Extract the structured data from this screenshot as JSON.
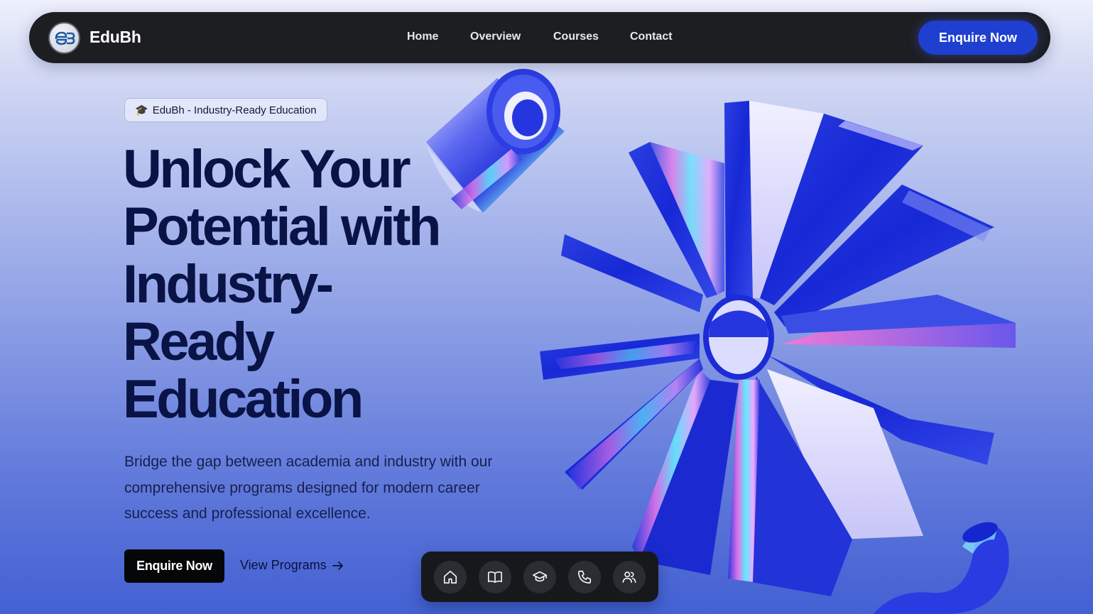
{
  "navbar": {
    "brand": "EduBh",
    "links": [
      "Home",
      "Overview",
      "Courses",
      "Contact"
    ],
    "cta": "Enquire Now"
  },
  "hero": {
    "badge": "EduBh - Industry-Ready Education",
    "headline_lines": [
      "Unlock Your",
      "Potential with",
      "Industry-",
      "Ready",
      "Education"
    ],
    "subtext": "Bridge the gap between academia and industry with our comprehensive programs designed for modern career success and professional excellence.",
    "primary_button": "Enquire Now",
    "secondary_link": "View Programs"
  },
  "dock": {
    "icons": [
      "home-icon",
      "book-icon",
      "graduation-cap-icon",
      "phone-icon",
      "users-icon"
    ]
  },
  "colors": {
    "navbar_bg": "#1d1e22",
    "cta_blue": "#1f3fd0",
    "headline": "#091345",
    "primary_button_bg": "#050608"
  }
}
